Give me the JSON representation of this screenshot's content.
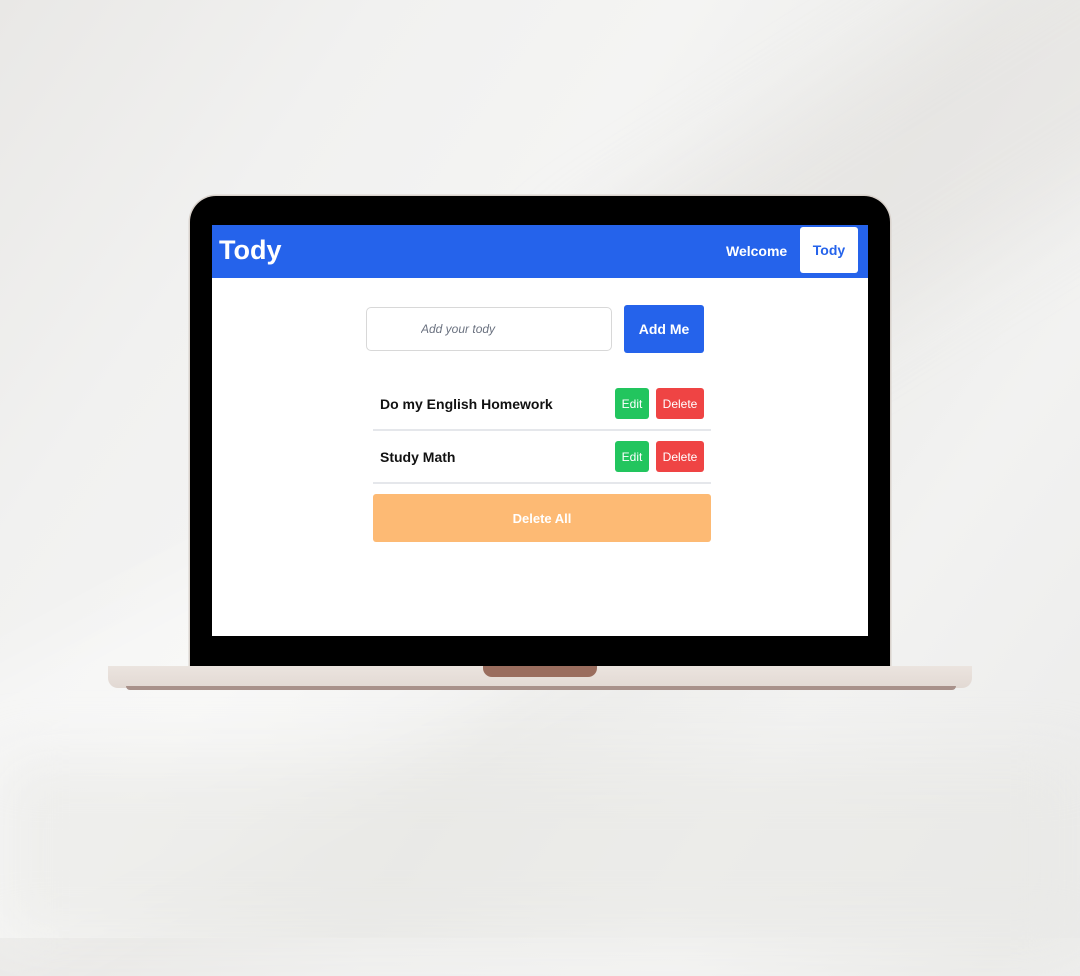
{
  "app": {
    "brand": "Tody"
  },
  "nav": {
    "welcome_label": "Welcome",
    "tody_label": "Tody"
  },
  "form": {
    "input_placeholder": "Add your tody",
    "input_value": "",
    "add_label": "Add Me"
  },
  "todos": [
    {
      "text": "Do my English Homework",
      "edit_label": "Edit",
      "delete_label": "Delete"
    },
    {
      "text": "Study Math",
      "edit_label": "Edit",
      "delete_label": "Delete"
    }
  ],
  "actions": {
    "delete_all_label": "Delete All"
  },
  "colors": {
    "primary": "#2563eb",
    "edit": "#22c55e",
    "delete": "#ef4444",
    "delete_all": "#fdba74",
    "bezel": "#000000"
  }
}
